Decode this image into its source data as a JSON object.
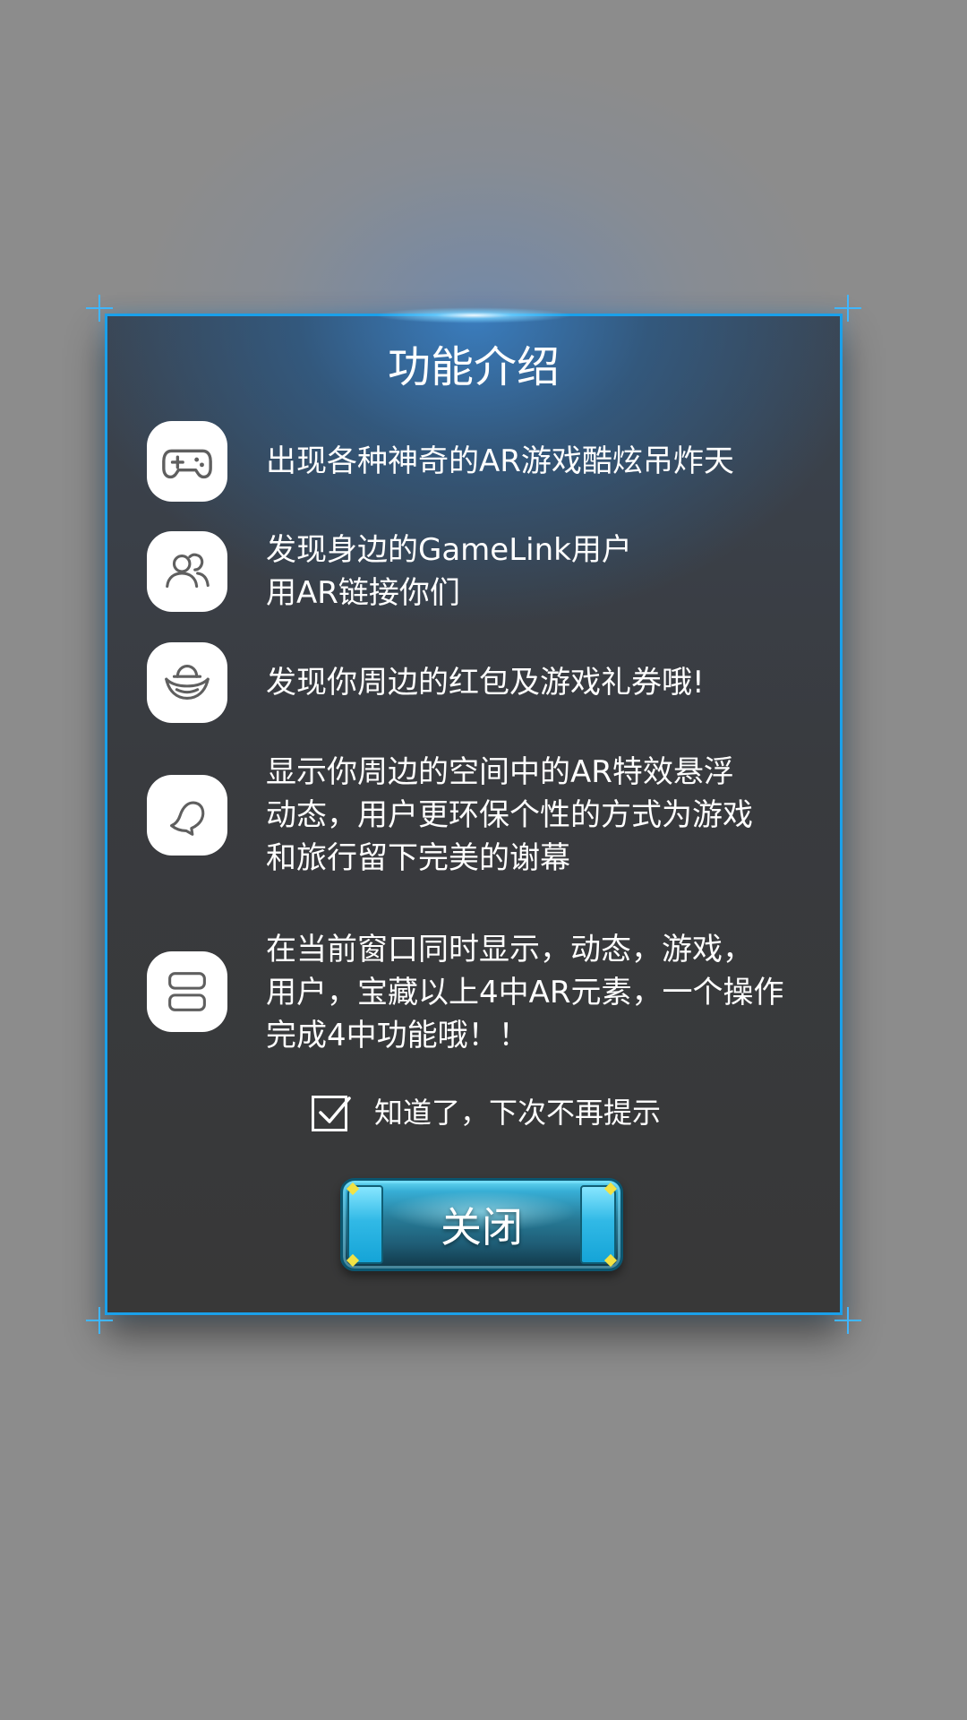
{
  "dialog": {
    "title": "功能介绍",
    "features": [
      {
        "icon": "gamepad-icon",
        "text": "出现各种神奇的AR游戏酷炫吊炸天"
      },
      {
        "icon": "users-icon",
        "text": "发现身边的GameLink用户\n用AR链接你们"
      },
      {
        "icon": "gold-ingot-icon",
        "text": "发现你周边的红包及游戏礼券哦!"
      },
      {
        "icon": "ghost-icon",
        "text": "显示你周边的空间中的AR特效悬浮\n动态，用户更环保个性的方式为游戏\n和旅行留下完美的谢幕"
      },
      {
        "icon": "stack-icon",
        "text": "在当前窗口同时显示，动态，游戏，\n用户，宝藏以上4中AR元素，一个操作\n完成4中功能哦！！"
      }
    ],
    "checkbox_label": "知道了，下次不再提示",
    "checkbox_checked": true,
    "close_label": "关闭"
  },
  "colors": {
    "page_background": "#8c8c8c",
    "dialog_border": "#1aa0ea",
    "button_cyan": "#37aed5",
    "text": "#ffffff"
  }
}
